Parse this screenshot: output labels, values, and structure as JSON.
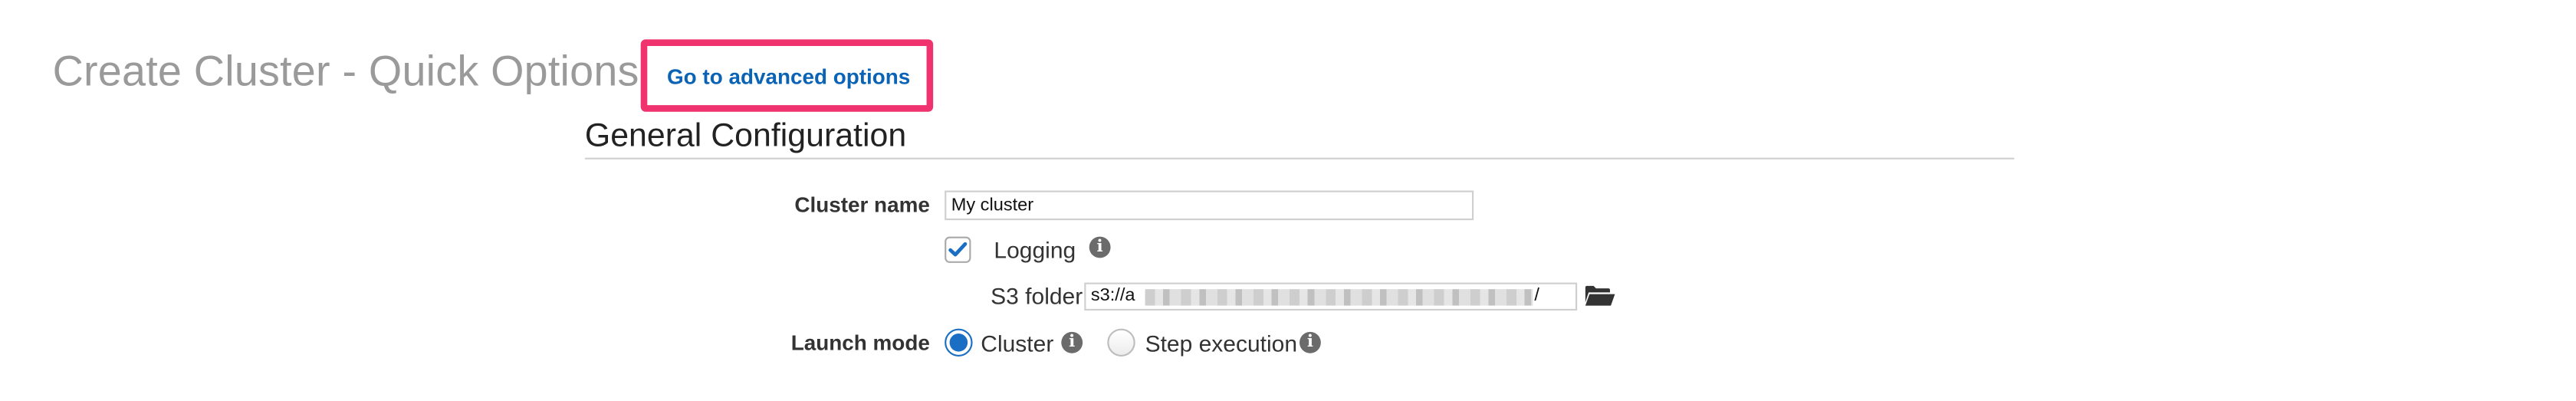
{
  "header": {
    "title": "Create Cluster - Quick Options",
    "advanced_link": "Go to advanced options"
  },
  "general_config": {
    "section_title": "General Configuration",
    "cluster_name": {
      "label": "Cluster name",
      "value": "My cluster"
    },
    "logging": {
      "label": "Logging",
      "checked": true,
      "info_icon": "info-icon"
    },
    "s3_folder": {
      "label": "S3 folder",
      "value_prefix": "s3://a",
      "value_suffix": "/",
      "folder_icon": "folder-open-icon"
    },
    "launch_mode": {
      "label": "Launch mode",
      "options": [
        {
          "label": "Cluster",
          "selected": true
        },
        {
          "label": "Step execution",
          "selected": false
        }
      ]
    }
  },
  "colors": {
    "link": "#0b63b5",
    "highlight_border": "#f0336e",
    "title_gray": "#9a9a9a",
    "radio_blue": "#1a6fc4"
  }
}
